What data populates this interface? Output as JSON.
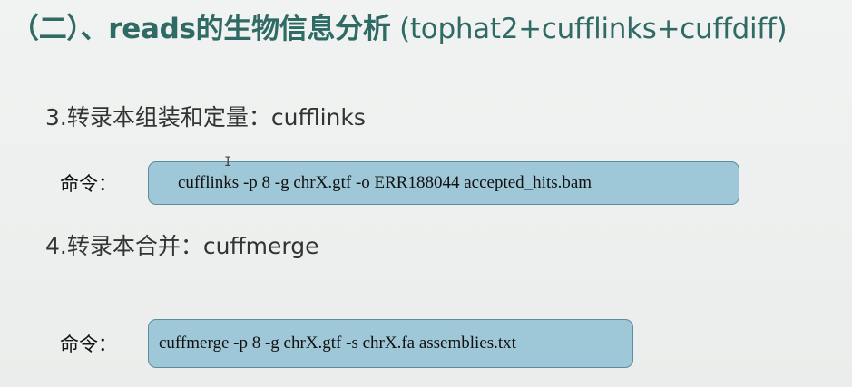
{
  "title": {
    "bold": "（二）、reads的生物信息分析",
    "light": " (tophat2+cufflinks+cuffdiff)"
  },
  "steps": [
    {
      "heading": "3.转录本组装和定量：cufflinks",
      "cmd_label": "命令：",
      "command": "cufflinks -p 8 -g chrX.gtf -o ERR188044  accepted_hits.bam"
    },
    {
      "heading": "4.转录本合并：cuffmerge",
      "cmd_label": "命令：",
      "command": "cuffmerge -p 8 -g chrX.gtf -s chrX.fa assemblies.txt"
    }
  ],
  "colors": {
    "title": "#2f6a64",
    "command_box_fill": "#9ec7d7",
    "command_box_border": "#5d8ca1"
  }
}
